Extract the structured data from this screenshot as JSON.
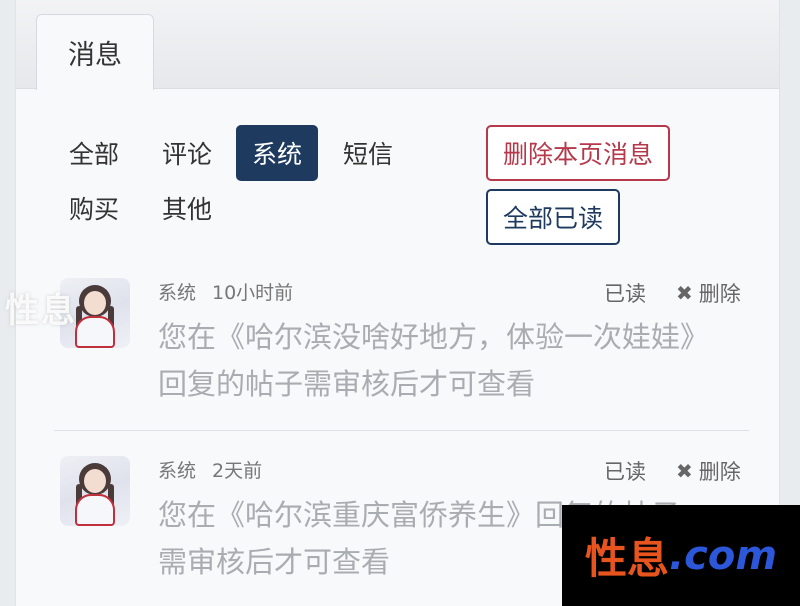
{
  "tabs": {
    "active_label": "消息"
  },
  "filters": {
    "all": "全部",
    "comments": "评论",
    "system": "系统",
    "sms": "短信",
    "purchase": "购买",
    "other": "其他"
  },
  "actions": {
    "delete_page": "删除本页消息",
    "mark_all_read": "全部已读"
  },
  "messages": [
    {
      "source": "系统",
      "time": "10小时前",
      "read_label": "已读",
      "delete_label": "删除",
      "text": "您在《哈尔滨没啥好地方，体验一次娃娃》回复的帖子需审核后才可查看"
    },
    {
      "source": "系统",
      "time": "2天前",
      "read_label": "已读",
      "delete_label": "删除",
      "text": "您在《哈尔滨重庆富侨养生》回复的帖子需审核后才可查看"
    }
  ],
  "icons": {
    "delete": "close-icon",
    "avatar": "user-avatar"
  },
  "colors": {
    "accent": "#1e3a5f",
    "danger": "#b5394b",
    "watermark_cn": "#e8541e",
    "watermark_en": "#2b57d8"
  },
  "watermark": {
    "cn": "性息",
    "en": ".com",
    "top_overlay": "性息"
  }
}
